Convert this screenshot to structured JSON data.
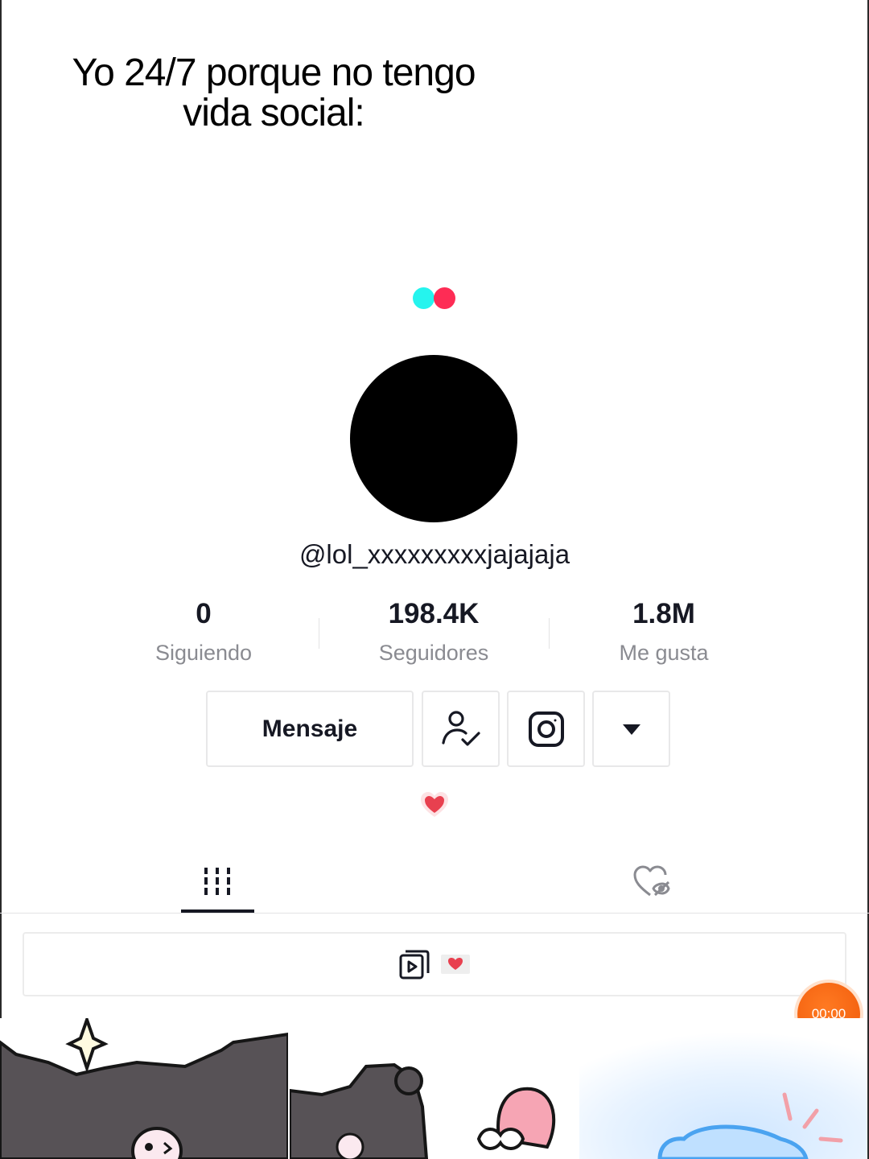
{
  "caption": {
    "line1": "Yo 24/7 porque no tengo",
    "line2": "vida social:"
  },
  "profile": {
    "username": "@lol_xxxxxxxxxjajajaja"
  },
  "stats": [
    {
      "value": "0",
      "label": "Siguiendo"
    },
    {
      "value": "198.4K",
      "label": "Seguidores"
    },
    {
      "value": "1.8M",
      "label": "Me gusta"
    }
  ],
  "actions": {
    "message_label": "Mensaje",
    "following_icon": "user-check-icon",
    "instagram_icon": "instagram-icon",
    "more_icon": "caret-down-icon"
  },
  "bio": {
    "icon": "heart-icon"
  },
  "tabs": [
    {
      "icon": "videos-grid-icon",
      "active": true
    },
    {
      "icon": "liked-hidden-icon",
      "active": false
    }
  ],
  "playlist": {
    "icon": "playlist-icon",
    "badge_icon": "heart-letter-icon"
  },
  "timer": {
    "text": "00:00"
  },
  "colors": {
    "brand_cyan": "#25f4ee",
    "brand_red": "#fe2c55",
    "timer_orange": "#f26210",
    "text_primary": "#161823",
    "text_secondary": "#8a8b91"
  }
}
